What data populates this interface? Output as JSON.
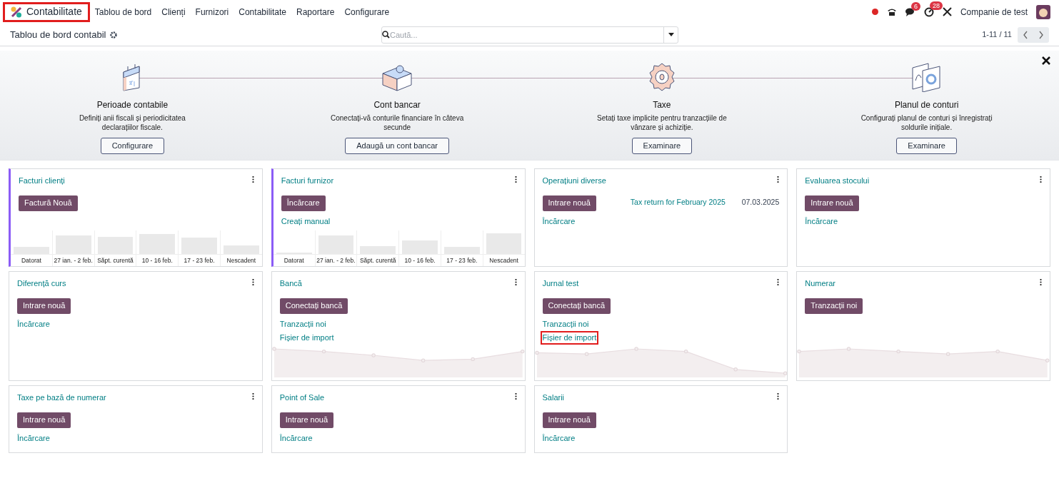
{
  "navbar": {
    "app": {
      "label": "Contabilitate",
      "highlighted": true
    },
    "menu": [
      "Tablou de bord",
      "Clienți",
      "Furnizori",
      "Contabilitate",
      "Raportare",
      "Configurare"
    ],
    "badges": {
      "messages": "6",
      "activities": "28"
    },
    "company": "Companie de test"
  },
  "control_panel": {
    "title": "Tablou de bord contabil",
    "search": {
      "placeholder": "Caută..."
    },
    "pager": "1-11 / 11"
  },
  "onboarding": {
    "steps": [
      {
        "kind": "calendar",
        "title": "Perioade contabile",
        "description": "Definiți anii fiscali și periodicitatea declarațiilor fiscale.",
        "button": "Configurare"
      },
      {
        "kind": "puzzle",
        "title": "Cont bancar",
        "description": "Conectați-vă conturile financiare în câteva secunde",
        "button": "Adaugă un cont bancar"
      },
      {
        "kind": "gear",
        "title": "Taxe",
        "description": "Setați taxe implicite pentru tranzacțiile de vânzare și achiziție.",
        "button": "Examinare"
      },
      {
        "kind": "charts",
        "title": "Planul de conturi",
        "description": "Configurați planul de conturi și înregistrați soldurile inițiale.",
        "button": "Examinare"
      }
    ]
  },
  "journals": [
    {
      "title": "Facturi clienți",
      "accent": true,
      "button": "Factură Nouă",
      "kind": "bars",
      "bar_labels": [
        "Datorat",
        "27 ian. - 2 feb.",
        "Săpt. curentă",
        "10 - 16 feb.",
        "17 - 23 feb.",
        "Nescadent"
      ]
    },
    {
      "title": "Facturi furnizor",
      "accent": true,
      "button": "Încărcare",
      "links": [
        {
          "label": "Creați manual",
          "highlighted": false
        }
      ],
      "kind": "bars",
      "bar_labels": [
        "Datorat",
        "27 ian. - 2 feb.",
        "Săpt. curentă",
        "10 - 16 feb.",
        "17 - 23 feb.",
        "Nescadent"
      ]
    },
    {
      "title": "Operațiuni diverse",
      "accent": false,
      "button": "Intrare nouă",
      "links": [
        {
          "label": "Încărcare",
          "highlighted": false
        }
      ],
      "kind": "plain",
      "activity": {
        "text": "Tax return for February 2025",
        "date": "07.03.2025"
      }
    },
    {
      "title": "Evaluarea stocului",
      "accent": false,
      "button": "Intrare nouă",
      "links": [
        {
          "label": "Încărcare",
          "highlighted": false
        }
      ],
      "kind": "plain"
    },
    {
      "title": "Diferență curs",
      "accent": false,
      "button": "Intrare nouă",
      "links": [
        {
          "label": "Încărcare",
          "highlighted": false
        }
      ],
      "kind": "plain"
    },
    {
      "title": "Bancă",
      "accent": false,
      "button": "Conectați bancă",
      "links": [
        {
          "label": "Tranzacții noi",
          "highlighted": false
        },
        {
          "label": "Fișier de import",
          "highlighted": false
        }
      ],
      "kind": "line"
    },
    {
      "title": "Jurnal test",
      "accent": false,
      "button": "Conectați bancă",
      "links": [
        {
          "label": "Tranzacții noi",
          "highlighted": false
        },
        {
          "label": "Fișier de import",
          "highlighted": true
        }
      ],
      "kind": "line"
    },
    {
      "title": "Numerar",
      "accent": false,
      "button": "Tranzacții noi",
      "kind": "line"
    },
    {
      "title": "Taxe pe bază de numerar",
      "accent": false,
      "button": "Intrare nouă",
      "links": [
        {
          "label": "Încărcare",
          "highlighted": false
        }
      ],
      "kind": "plain"
    },
    {
      "title": "Point of Sale",
      "accent": false,
      "button": "Intrare nouă",
      "links": [
        {
          "label": "Încărcare",
          "highlighted": false
        }
      ],
      "kind": "plain"
    },
    {
      "title": "Salarii",
      "accent": false,
      "button": "Intrare nouă",
      "links": [
        {
          "label": "Încărcare",
          "highlighted": false
        }
      ],
      "kind": "plain"
    }
  ]
}
